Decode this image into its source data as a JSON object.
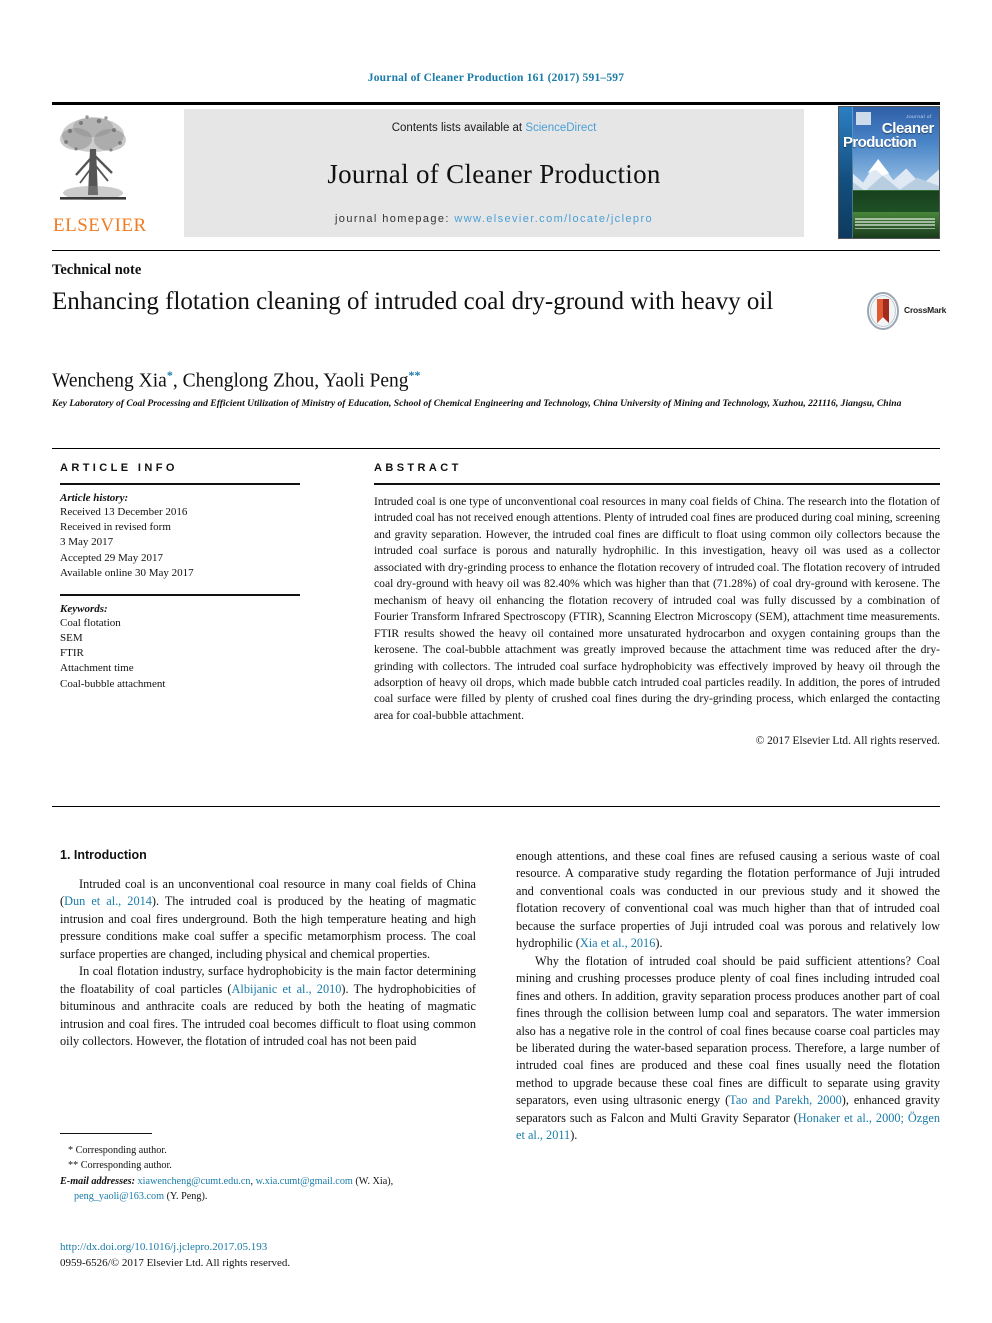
{
  "running_head": "Journal of Cleaner Production 161 (2017) 591–597",
  "masthead": {
    "publisher": "ELSEVIER",
    "contents_prefix": "Contents lists available at ",
    "contents_link": "ScienceDirect",
    "journal_title": "Journal of Cleaner Production",
    "homepage_prefix": "journal homepage: ",
    "homepage_url": "www.elsevier.com/locate/jclepro",
    "cover": {
      "line1": "Journal of",
      "line2": "Cleaner",
      "line3": "Production",
      "publisher_mark": "ELSEVIER"
    }
  },
  "article": {
    "type": "Technical note",
    "title": "Enhancing flotation cleaning of intruded coal dry-ground with heavy oil",
    "crossmark_label": "CrossMark",
    "authors": [
      {
        "name": "Wencheng Xia",
        "mark": "*"
      },
      {
        "name": "Chenglong Zhou",
        "mark": ""
      },
      {
        "name": "Yaoli Peng",
        "mark": "**"
      }
    ],
    "affiliation": "Key Laboratory of Coal Processing and Efficient Utilization of Ministry of Education, School of Chemical Engineering and Technology, China University of Mining and Technology, Xuzhou, 221116, Jiangsu, China"
  },
  "info": {
    "heading": "ARTICLE INFO",
    "history_label": "Article history:",
    "history": [
      "Received 13 December 2016",
      "Received in revised form",
      "3 May 2017",
      "Accepted 29 May 2017",
      "Available online 30 May 2017"
    ],
    "keywords_label": "Keywords:",
    "keywords": [
      "Coal flotation",
      "SEM",
      "FTIR",
      "Attachment time",
      "Coal-bubble attachment"
    ]
  },
  "abstract": {
    "heading": "ABSTRACT",
    "text": "Intruded coal is one type of unconventional coal resources in many coal fields of China. The research into the flotation of intruded coal has not received enough attentions. Plenty of intruded coal fines are produced during coal mining, screening and gravity separation. However, the intruded coal fines are difficult to float using common oily collectors because the intruded coal surface is porous and naturally hydrophilic. In this investigation, heavy oil was used as a collector associated with dry-grinding process to enhance the flotation recovery of intruded coal. The flotation recovery of intruded coal dry-ground with heavy oil was 82.40% which was higher than that (71.28%) of coal dry-ground with kerosene. The mechanism of heavy oil enhancing the flotation recovery of intruded coal was fully discussed by a combination of Fourier Transform Infrared Spectroscopy (FTIR), Scanning Electron Microscopy (SEM), attachment time measurements. FTIR results showed the heavy oil contained more unsaturated hydrocarbon and oxygen containing groups than the kerosene. The coal-bubble attachment was greatly improved because the attachment time was reduced after the dry-grinding with collectors. The intruded coal surface hydrophobicity was effectively improved by heavy oil through the adsorption of heavy oil drops, which made bubble catch intruded coal particles readily. In addition, the pores of intruded coal surface were filled by plenty of crushed coal fines during the dry-grinding process, which enlarged the contacting area for coal-bubble attachment.",
    "copyright": "© 2017 Elsevier Ltd. All rights reserved."
  },
  "introduction": {
    "heading": "1. Introduction",
    "left_paragraphs": [
      {
        "parts": [
          {
            "t": "Intruded coal is an unconventional coal resource in many coal fields of China (",
            "c": false
          },
          {
            "t": "Dun et al., 2014",
            "c": true
          },
          {
            "t": "). The intruded coal is produced by the heating of magmatic intrusion and coal fires underground. Both the high temperature heating and high pressure conditions make coal suffer a specific metamorphism process. The coal surface properties are changed, including physical and chemical properties.",
            "c": false
          }
        ]
      },
      {
        "parts": [
          {
            "t": "In coal flotation industry, surface hydrophobicity is the main factor determining the floatability of coal particles (",
            "c": false
          },
          {
            "t": "Albijanic et al., 2010",
            "c": true
          },
          {
            "t": "). The hydrophobicities of bituminous and anthracite coals are reduced by both the heating of magmatic intrusion and coal fires. The intruded coal becomes difficult to float using common oily collectors. However, the flotation of intruded coal has not been paid",
            "c": false
          }
        ]
      }
    ],
    "right_paragraphs": [
      {
        "indent": false,
        "parts": [
          {
            "t": "enough attentions, and these coal fines are refused causing a serious waste of coal resource. A comparative study regarding the flotation performance of Juji intruded and conventional coals was conducted in our previous study and it showed the flotation recovery of conventional coal was much higher than that of intruded coal because the surface properties of Juji intruded coal was porous and relatively low hydrophilic (",
            "c": false
          },
          {
            "t": "Xia et al., 2016",
            "c": true
          },
          {
            "t": ").",
            "c": false
          }
        ]
      },
      {
        "indent": true,
        "parts": [
          {
            "t": "Why the flotation of intruded coal should be paid sufficient attentions? Coal mining and crushing processes produce plenty of coal fines including intruded coal fines and others. In addition, gravity separation process produces another part of coal fines through the collision between lump coal and separators. The water immersion also has a negative role in the control of coal fines because coarse coal particles may be liberated during the water-based separation process. Therefore, a large number of intruded coal fines are produced and these coal fines usually need the flotation method to upgrade because these coal fines are difficult to separate using gravity separators, even using ultrasonic energy (",
            "c": false
          },
          {
            "t": "Tao and Parekh, 2000",
            "c": true
          },
          {
            "t": "), enhanced gravity separators such as Falcon and Multi Gravity Separator (",
            "c": false
          },
          {
            "t": "Honaker et al., 2000; Özgen et al., 2011",
            "c": true
          },
          {
            "t": ").",
            "c": false
          }
        ]
      }
    ]
  },
  "footnotes": {
    "corresponding_1": "* Corresponding author.",
    "corresponding_2": "** Corresponding author.",
    "email_label": "E-mail addresses:",
    "emails": [
      {
        "address": "xiawencheng@cumt.edu.cn",
        "sep": ", "
      },
      {
        "address": "w.xia.cumt@gmail.com",
        "sep": " "
      }
    ],
    "email_owner_1": "(W. Xia),",
    "email_3": "peng_yaoli@163.com",
    "email_owner_2": "(Y. Peng).",
    "doi": "http://dx.doi.org/10.1016/j.jclepro.2017.05.193",
    "issn": "0959-6526/© 2017 Elsevier Ltd. All rights reserved."
  },
  "colors": {
    "link_blue": "#1a7ba8",
    "sciencedirect_blue": "#4a9fd5",
    "elsevier_orange": "#f07c24"
  }
}
